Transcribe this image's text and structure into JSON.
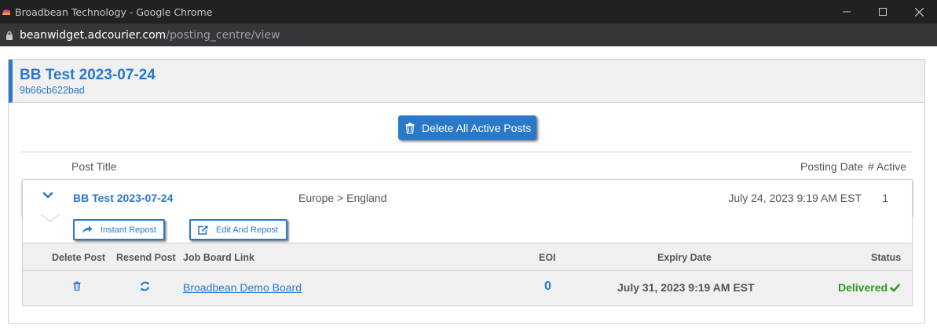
{
  "window": {
    "title": "Broadbean Technology - Google Chrome",
    "url_domain": "beanwidget.adcourier.com",
    "url_path": "/posting_centre/view"
  },
  "header": {
    "title": "BB Test 2023-07-24",
    "subtitle": "9b66cb622bad"
  },
  "actions": {
    "delete_all_label": "Delete All Active Posts"
  },
  "columns": {
    "post_title": "Post Title",
    "posting_date": "Posting Date",
    "active": "# Active"
  },
  "post": {
    "title": "BB Test 2023-07-24",
    "location": "Europe > England",
    "posting_date": "July 24, 2023 9:19 AM EST",
    "active_count": "1",
    "instant_repost_label": "Instant Repost",
    "edit_repost_label": "Edit And Repost"
  },
  "boards_table": {
    "headers": {
      "delete_post": "Delete Post",
      "resend_post": "Resend Post",
      "job_board_link": "Job Board Link",
      "eoi": "EOI",
      "expiry_date": "Expiry Date",
      "status": "Status"
    },
    "rows": [
      {
        "job_board": "Broadbean Demo Board",
        "eoi": "0",
        "expiry_date": "July 31, 2023 9:19 AM EST",
        "status": "Delivered"
      }
    ]
  },
  "colors": {
    "accent": "#2a78c8",
    "success": "#2a9a1e",
    "chrome_dark": "#202124"
  },
  "icons": {
    "trash": "trash-icon",
    "repost": "share-arrow-icon",
    "edit": "external-edit-icon",
    "resend": "refresh-icon",
    "expand": "chevron-down-icon",
    "delivered": "check-icon",
    "secure": "lock-icon"
  }
}
